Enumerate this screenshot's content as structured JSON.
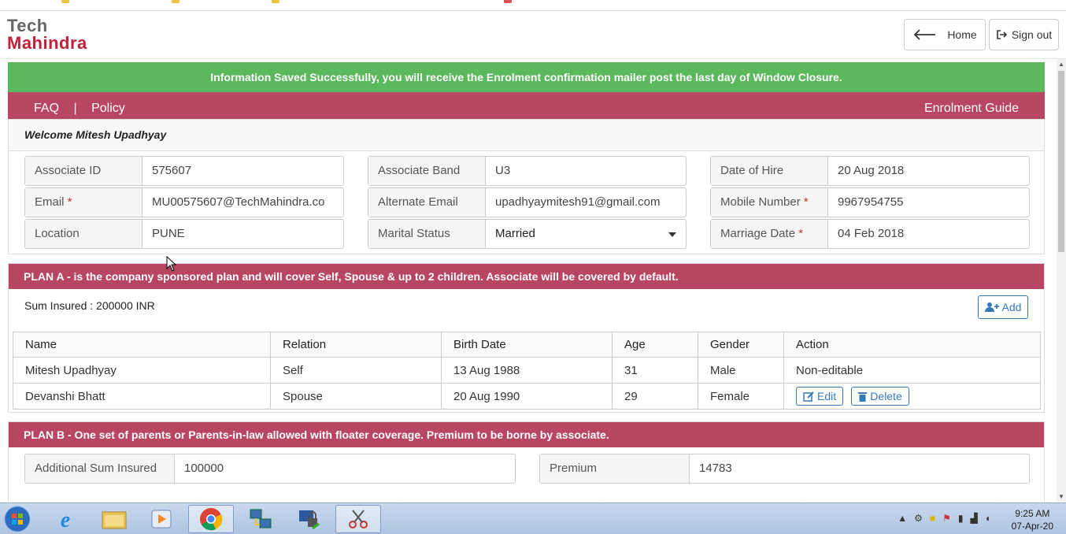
{
  "topbar": {
    "logo_line1": "Tech",
    "logo_line2": "Mahindra",
    "home_label": "Home",
    "signout_label": "Sign out"
  },
  "alert": {
    "message": "Information Saved Successfully, you will receive the Enrolment confirmation mailer post the last day of Window Closure."
  },
  "menu": {
    "faq": "FAQ",
    "separator": "|",
    "policy": "Policy",
    "guide": "Enrolment Guide"
  },
  "welcome": "Welcome Mitesh Upadhyay",
  "profile": {
    "associate_id": {
      "label": "Associate ID",
      "value": "575607"
    },
    "associate_band": {
      "label": "Associate Band",
      "value": "U3"
    },
    "date_of_hire": {
      "label": "Date of Hire",
      "value": "20 Aug 2018"
    },
    "email": {
      "label": "Email",
      "value": "MU00575607@TechMahindra.co"
    },
    "alternate_email": {
      "label": "Alternate Email",
      "value": "upadhyaymitesh91@gmail.com"
    },
    "mobile": {
      "label": "Mobile Number",
      "value": "9967954755"
    },
    "location": {
      "label": "Location",
      "value": "PUNE"
    },
    "marital_status": {
      "label": "Marital Status",
      "value": "Married"
    },
    "marriage_date": {
      "label": "Marriage Date",
      "value": "04 Feb 2018"
    },
    "required_mark": "*"
  },
  "plan_a": {
    "heading": "PLAN A - is the company sponsored plan and will cover Self, Spouse & up to 2 children. Associate will be covered by default.",
    "sum_insured": "Sum Insured : 200000 INR",
    "add_label": "Add",
    "columns": [
      "Name",
      "Relation",
      "Birth Date",
      "Age",
      "Gender",
      "Action"
    ],
    "rows": [
      {
        "name": "Mitesh Upadhyay",
        "relation": "Self",
        "birth_date": "13 Aug 1988",
        "age": "31",
        "gender": "Male",
        "action": "Non-editable"
      },
      {
        "name": "Devanshi Bhatt",
        "relation": "Spouse",
        "birth_date": "20 Aug 1990",
        "age": "29",
        "gender": "Female",
        "edit_label": "Edit",
        "delete_label": "Delete"
      }
    ]
  },
  "plan_b": {
    "heading": "PLAN B - One set of parents or Parents-in-law allowed with floater coverage. Premium to be borne by associate.",
    "additional_sum": {
      "label": "Additional Sum Insured",
      "value": "100000"
    },
    "premium": {
      "label": "Premium",
      "value": "14783"
    }
  },
  "taskbar": {
    "time": "9:25 AM",
    "date": "07-Apr-20"
  }
}
